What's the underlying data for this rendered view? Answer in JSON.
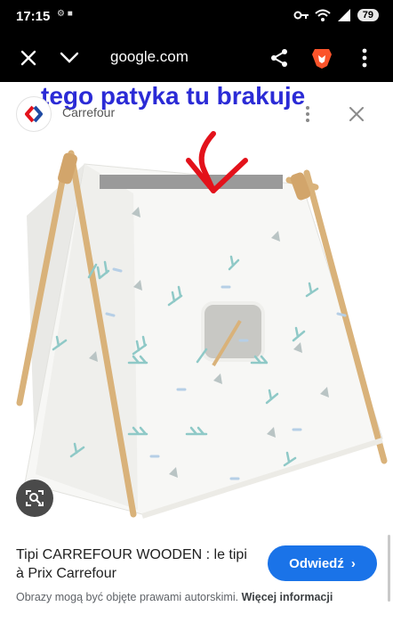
{
  "status_bar": {
    "time": "17:15",
    "left_icons": "⚙ ■",
    "battery": "79"
  },
  "browser": {
    "url": "google.com"
  },
  "image": {
    "overlay_caption": "tego patyka tu brakuje",
    "source_name": "Carrefour",
    "source_letter": "C"
  },
  "result": {
    "title": "Tipi CARREFOUR WOODEN : le tipi à Prix Carrefour",
    "visit_button": "Odwiedź",
    "visit_chevron": "›",
    "copyright_text": "Obrazy mogą być objęte prawami autorskimi.",
    "more_info": "Więcej informacji"
  },
  "colors": {
    "annotation_text": "#2b2bd6",
    "annotation_arrow": "#e3121b",
    "button": "#1a73e8",
    "tent_fabric": "#f7f7f5",
    "pattern": "#8fc9c7"
  }
}
